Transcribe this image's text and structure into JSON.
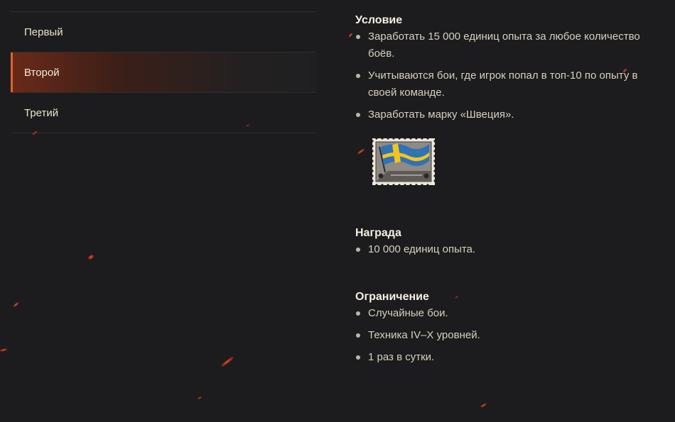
{
  "tabs": [
    {
      "label": "Первый",
      "active": false
    },
    {
      "label": "Второй",
      "active": true
    },
    {
      "label": "Третий",
      "active": false
    }
  ],
  "condition": {
    "title": "Условие",
    "items": [
      "Заработать 15 000 единиц опыта за любое количество боёв.",
      "Учитываются бои, где игрок попал в топ-10 по опыту в своей команде.",
      "Заработать марку «Швеция»."
    ],
    "stamp_icon": "sweden-flag-stamp-icon"
  },
  "reward": {
    "title": "Награда",
    "items": [
      "10 000 единиц опыта."
    ]
  },
  "limits": {
    "title": "Ограничение",
    "items": [
      "Случайные бои.",
      "Техника IV–X уровней.",
      "1 раз в сутки."
    ]
  },
  "colors": {
    "background": "#1c1c1e",
    "accent": "#e0602a",
    "text": "#d6d0bd",
    "heading": "#f4efe0"
  }
}
